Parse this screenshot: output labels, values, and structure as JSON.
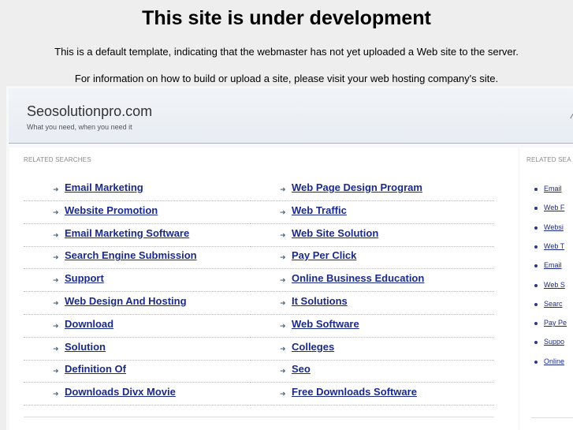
{
  "notice": {
    "title": "This site is under development",
    "line1": "This is a default template, indicating that the webmaster has not yet uploaded a Web site to the server.",
    "line2": "For information on how to build or upload a site, please visit your web hosting company's site."
  },
  "header": {
    "site_name": "Seosolutionpro.com",
    "tagline": "What you need, when you need it",
    "arrow_glyph": "⁄"
  },
  "main": {
    "section_title": "RELATED SEARCHES",
    "arrow_glyph": "➜",
    "left_links": [
      "Email Marketing",
      "Website Promotion",
      "Email Marketing Software",
      "Search Engine Submission",
      "Support",
      "Web Design And Hosting",
      "Download",
      "Solution",
      "Definition Of",
      "Downloads Divx Movie"
    ],
    "right_links": [
      "Web Page Design Program",
      "Web Traffic",
      "Web Site Solution",
      "Pay Per Click",
      "Online Business Education",
      "It Solutions",
      "Web Software",
      "Colleges",
      "Seo",
      "Free Downloads Software"
    ]
  },
  "side": {
    "section_title": "RELATED SEA",
    "links": [
      "Email",
      "Web F",
      "Websi",
      "Web T",
      "Email",
      "Web S",
      "Searc",
      "Pay Pe",
      "Suppo",
      "Online"
    ]
  },
  "colors": {
    "link": "#1a2a8a",
    "header_border": "#9fb7d0"
  }
}
